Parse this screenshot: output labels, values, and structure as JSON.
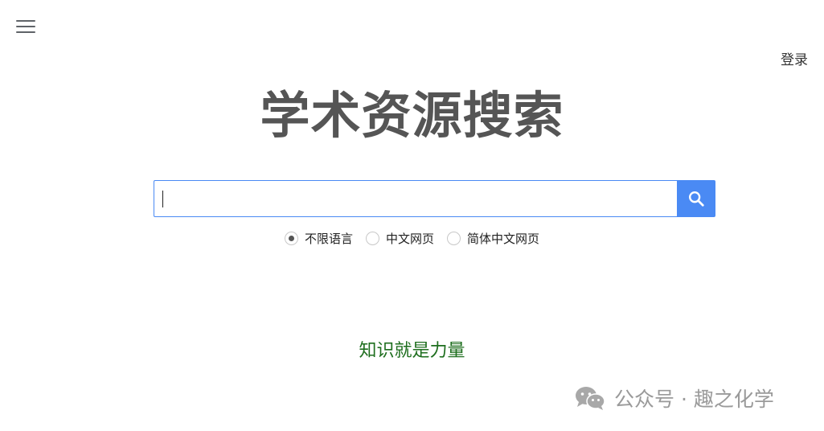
{
  "header": {
    "menu_icon": "hamburger-menu-icon",
    "login_label": "登录"
  },
  "main": {
    "title": "学术资源搜索",
    "search": {
      "value": "",
      "placeholder": "",
      "button_icon": "search-icon"
    },
    "language_options": [
      {
        "label": "不限语言",
        "selected": true
      },
      {
        "label": "中文网页",
        "selected": false
      },
      {
        "label": "简体中文网页",
        "selected": false
      }
    ],
    "motto": "知识就是力量"
  },
  "watermark": {
    "icon": "wechat-icon",
    "text": "公众号 · 趣之化学"
  },
  "colors": {
    "accent": "#4a8af4",
    "title": "#555555",
    "motto": "#1e6e1e"
  }
}
